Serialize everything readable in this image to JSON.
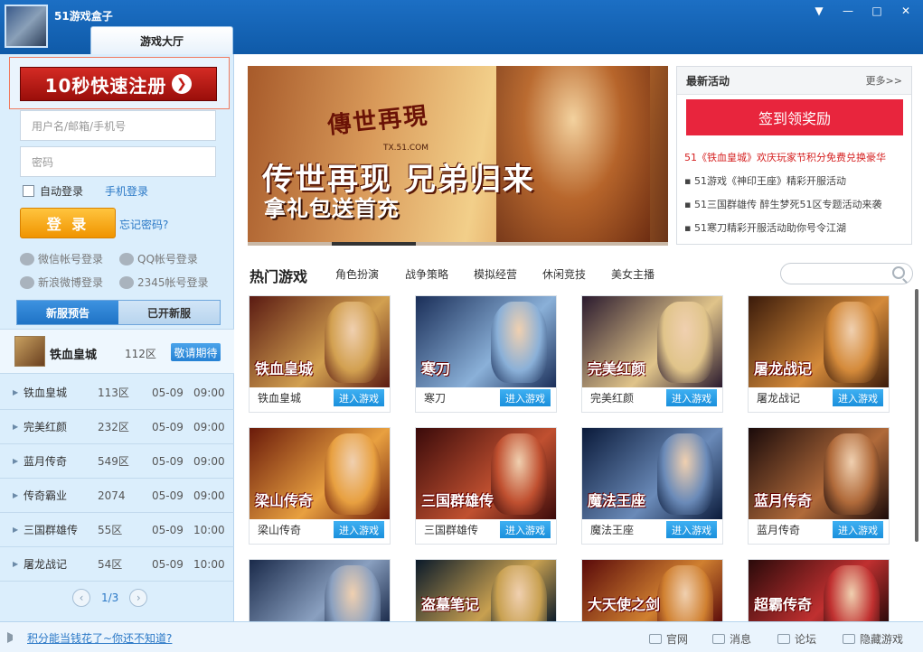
{
  "window": {
    "title": "51游戏盒子",
    "tab": "游戏大厅",
    "buttons": [
      "▼",
      "—",
      "□",
      "✕"
    ]
  },
  "login": {
    "register": "10秒快速注册",
    "username_placeholder": "用户名/邮箱/手机号",
    "password_placeholder": "密码",
    "auto_login": "自动登录",
    "mobile_login": "手机登录",
    "login_button": "登 录",
    "forgot": "忘记密码?",
    "social": [
      "微信帐号登录",
      "QQ帐号登录",
      "新浪微博登录",
      "2345帐号登录"
    ]
  },
  "servers": {
    "tabs": [
      "新服预告",
      "已开新服"
    ],
    "featured": {
      "name": "铁血皇城",
      "zone": "112区",
      "action": "敬请期待"
    },
    "rows": [
      {
        "name": "铁血皇城",
        "zone": "113区",
        "date": "05-09",
        "time": "09:00"
      },
      {
        "name": "完美红颜",
        "zone": "232区",
        "date": "05-09",
        "time": "09:00"
      },
      {
        "name": "蓝月传奇",
        "zone": "549区",
        "date": "05-09",
        "time": "09:00"
      },
      {
        "name": "传奇霸业",
        "zone": "2074",
        "date": "05-09",
        "time": "09:00"
      },
      {
        "name": "三国群雄传",
        "zone": "55区",
        "date": "05-09",
        "time": "10:00"
      },
      {
        "name": "屠龙战记",
        "zone": "54区",
        "date": "05-09",
        "time": "10:00"
      }
    ],
    "page": "1/3"
  },
  "banner": {
    "logo": "傳世再現",
    "logo_sub": "TX.51.COM",
    "line1": "传世再现 兄弟归来",
    "line2": "拿礼包送首充"
  },
  "activities": {
    "title": "最新活动",
    "more": "更多>>",
    "checkin": "签到领奖励",
    "items": [
      "51《铁血皇城》欢庆玩家节积分免费兑换豪华",
      "51游戏《神印王座》精彩开服活动",
      "51三国群雄传 醉生梦死51区专题活动来袭",
      "51寒刀精彩开服活动助你号令江湖"
    ]
  },
  "hot": {
    "title": "热门游戏",
    "categories": [
      "角色扮演",
      "战争策略",
      "模拟经营",
      "休闲竞技",
      "美女主播"
    ],
    "enter": "进入游戏",
    "games": [
      {
        "name": "铁血皇城",
        "logo": "铁血皇城",
        "colors": [
          "#5a1a12",
          "#d2a050"
        ]
      },
      {
        "name": "寒刀",
        "logo": "寒刀",
        "colors": [
          "#1a2e58",
          "#8ab0d8"
        ]
      },
      {
        "name": "完美红颜",
        "logo": "完美红颜",
        "colors": [
          "#2a1a2e",
          "#e0c48a"
        ]
      },
      {
        "name": "屠龙战记",
        "logo": "屠龙战记",
        "colors": [
          "#3a1a0a",
          "#d48a3a"
        ]
      },
      {
        "name": "梁山传奇",
        "logo": "梁山传奇",
        "colors": [
          "#6a1a0a",
          "#e8a040"
        ]
      },
      {
        "name": "三国群雄传",
        "logo": "三国群雄传",
        "colors": [
          "#3a0a0a",
          "#c05030"
        ]
      },
      {
        "name": "魔法王座",
        "logo": "魔法王座",
        "colors": [
          "#0a1a3a",
          "#6a8ab8"
        ]
      },
      {
        "name": "蓝月传奇",
        "logo": "蓝月传奇",
        "colors": [
          "#1a0a0a",
          "#b06a3a"
        ]
      },
      {
        "name": "",
        "logo": "",
        "colors": [
          "#1a2a4a",
          "#8aa0c0"
        ]
      },
      {
        "name": "",
        "logo": "盗墓笔记",
        "colors": [
          "#0a1a2a",
          "#c8a050"
        ]
      },
      {
        "name": "",
        "logo": "大天使之剑",
        "colors": [
          "#5a0a0a",
          "#d08030"
        ]
      },
      {
        "name": "",
        "logo": "超霸传奇",
        "colors": [
          "#2a0a0a",
          "#c03030"
        ]
      }
    ]
  },
  "footer": {
    "notice": "积分能当钱花了~你还不知道?",
    "links": [
      "官网",
      "消息",
      "论坛",
      "隐藏游戏"
    ]
  }
}
